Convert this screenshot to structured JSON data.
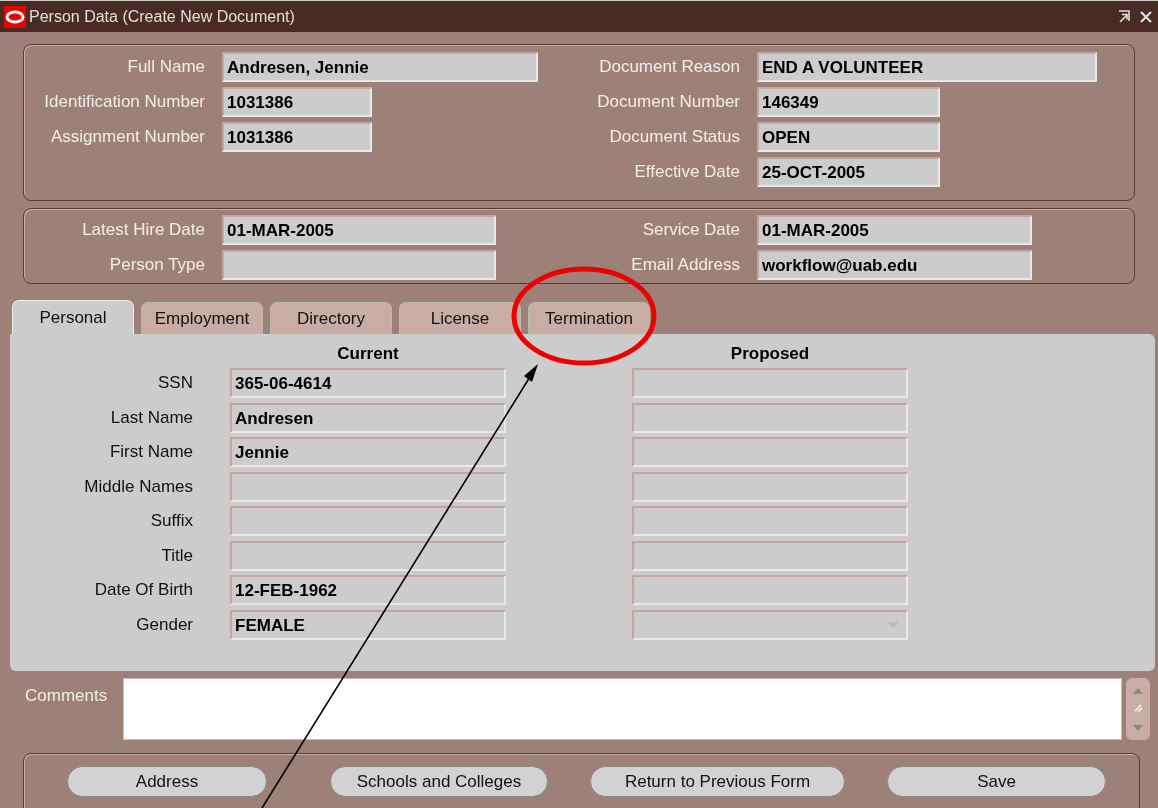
{
  "window": {
    "title": "Person Data (Create New Document)"
  },
  "header": {
    "left": [
      {
        "label": "Full Name",
        "value": "Andresen, Jennie"
      },
      {
        "label": "Identification Number",
        "value": "1031386"
      },
      {
        "label": "Assignment Number",
        "value": "1031386"
      }
    ],
    "right": [
      {
        "label": "Document Reason",
        "value": "END A VOLUNTEER"
      },
      {
        "label": "Document Number",
        "value": "146349"
      },
      {
        "label": "Document Status",
        "value": "OPEN"
      },
      {
        "label": "Effective Date",
        "value": "25-OCT-2005"
      }
    ]
  },
  "dates": {
    "left": [
      {
        "label": "Latest Hire Date",
        "value": "01-MAR-2005"
      },
      {
        "label": "Person Type"
      }
    ],
    "right": [
      {
        "label": "Service Date",
        "value": "01-MAR-2005"
      },
      {
        "label": "Email Address",
        "value": "workflow@uab.edu"
      }
    ]
  },
  "tabs": [
    {
      "label": "Personal",
      "selected": true
    },
    {
      "label": "Employment",
      "selected": false
    },
    {
      "label": "Directory",
      "selected": false
    },
    {
      "label": "License",
      "selected": false
    },
    {
      "label": "Termination",
      "selected": false
    }
  ],
  "personal": {
    "columns": [
      "Current",
      "Proposed"
    ],
    "rows": [
      {
        "label": "SSN",
        "current": "365-06-4614",
        "kind": "text"
      },
      {
        "label": "Last Name",
        "current": "Andresen",
        "kind": "text"
      },
      {
        "label": "First Name",
        "current": "Jennie",
        "kind": "text"
      },
      {
        "label": "Middle Names",
        "kind": "text"
      },
      {
        "label": "Suffix",
        "kind": "text"
      },
      {
        "label": "Title",
        "kind": "text"
      },
      {
        "label": "Date Of Birth",
        "current": "12-FEB-1962",
        "kind": "text"
      },
      {
        "label": "Gender",
        "current": "FEMALE",
        "kind": "dropdown"
      }
    ]
  },
  "comments": {
    "label": "Comments"
  },
  "buttons": [
    "Address",
    "Schools and Colleges",
    "Return to Previous Form",
    "Save"
  ],
  "annotations": {
    "highlight_ellipse": true,
    "pointer_arrow": true
  }
}
